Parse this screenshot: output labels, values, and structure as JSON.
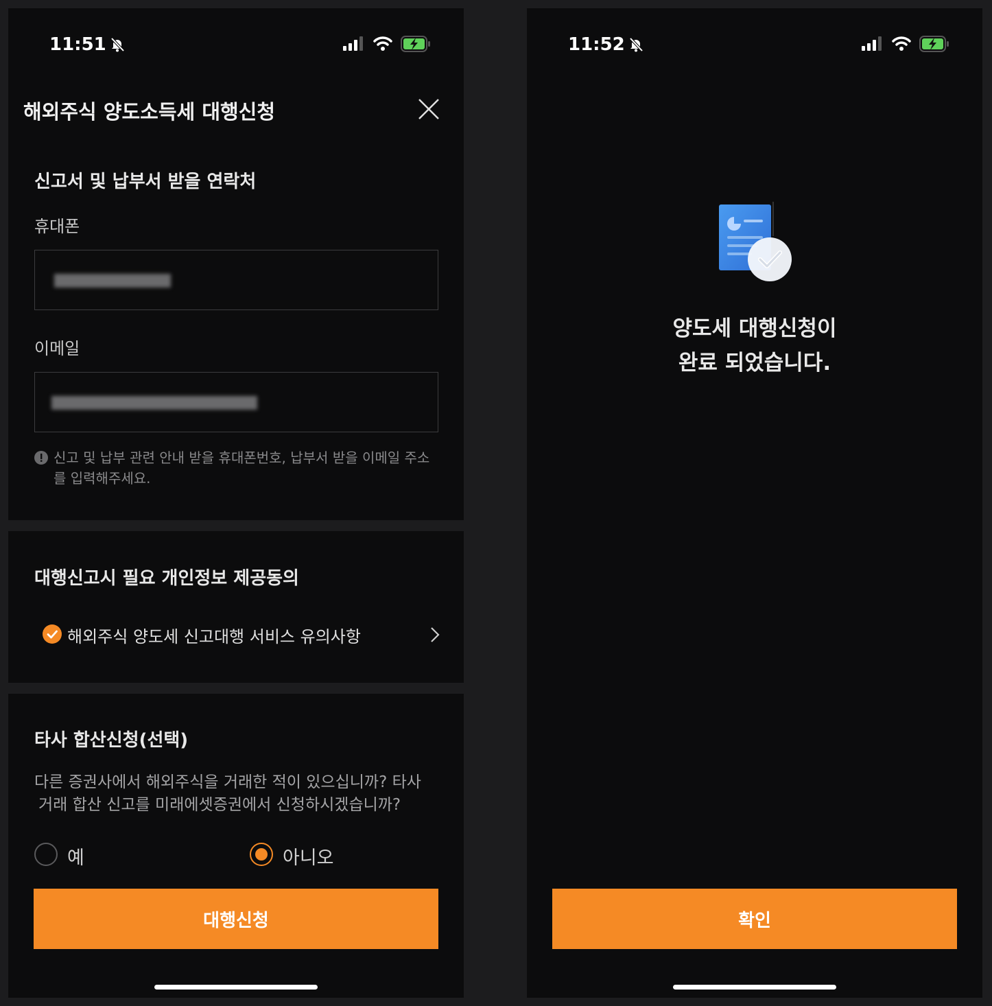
{
  "left_screen": {
    "status": {
      "time": "11:51"
    },
    "title": "해외주식 양도소득세 대행신청",
    "contact_section": {
      "heading": "신고서 및 납부서 받을 연락처",
      "phone_label": "휴대폰",
      "email_label": "이메일",
      "hint": "신고 및 납부 관련 안내 받을 휴대폰번호, 납부서 받을 이메일 주소를 입력해주세요."
    },
    "consent_section": {
      "heading": "대행신고시 필요 개인정보 제공동의",
      "agreement_item": "해외주식 양도세 신고대행 서비스 유의사항"
    },
    "combine_section": {
      "heading": "타사 합산신청(선택)",
      "description_line1": "다른 증권사에서 해외주식을 거래한 적이 있으십니까? 타사",
      "description_line2": "거래 합산 신고를 미래에셋증권에서 신청하시겠습니까?",
      "option_yes": "예",
      "option_no": "아니오",
      "selected": "아니오"
    },
    "submit_label": "대행신청"
  },
  "right_screen": {
    "status": {
      "time": "11:52"
    },
    "message_line1": "양도세 대행신청이",
    "message_line2": "완료 되었습니다.",
    "confirm_label": "확인"
  },
  "colors": {
    "accent": "#f58a25",
    "background": "#0c0c0d",
    "divider": "#1c1c1e"
  }
}
